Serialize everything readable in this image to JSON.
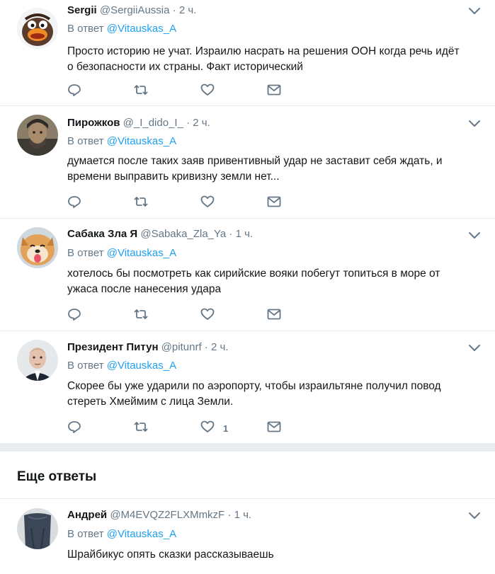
{
  "replies": [
    {
      "name": "Sergii",
      "handle": "@SergiiAussia",
      "dot": "·",
      "time": "2 ч.",
      "reply_prefix": "В ответ",
      "reply_to": "@Vitauskas_A",
      "text_lines": [
        "Просто историю не учат. Израилю насрать на решения ООН когда речь идёт",
        "о безопасности их страны. Факт исторический"
      ],
      "likes": ""
    },
    {
      "name": "Пирожков",
      "handle": "@_I_dido_I_",
      "dot": "·",
      "time": "2 ч.",
      "reply_prefix": "В ответ",
      "reply_to": "@Vitauskas_A",
      "text_lines": [
        "думается после таких заяв привентивный удар не заставит себя ждать, и",
        "времени выправить кривизну земли нет..."
      ],
      "likes": ""
    },
    {
      "name": "Сабака Зла Я",
      "handle": "@Sabaka_Zla_Ya",
      "dot": "·",
      "time": "1 ч.",
      "reply_prefix": "В ответ",
      "reply_to": "@Vitauskas_A",
      "text_lines": [
        "хотелось бы посмотреть как сирийские вояки побегут топиться в море от",
        "ужаса после нанесения удара"
      ],
      "likes": ""
    },
    {
      "name": "Президент Питун",
      "handle": "@pitunrf",
      "dot": "·",
      "time": "2 ч.",
      "reply_prefix": "В ответ",
      "reply_to": "@Vitauskas_A",
      "text_lines": [
        "Скорее бы уже ударили по аэропорту, чтобы израильтяне получил повод",
        "стереть Хмеймим с лица Земли."
      ],
      "likes": "1"
    }
  ],
  "more_replies_title": "Еще ответы",
  "more_replies": [
    {
      "name": "Андрей",
      "handle": "@M4EVQZ2FLXMmkzF",
      "dot": "·",
      "time": "1 ч.",
      "reply_prefix": "В ответ",
      "reply_to": "@Vitauskas_A",
      "text_lines": [
        "Шрайбикус опять сказки рассказываешь"
      ]
    }
  ],
  "icons": {
    "reply": "reply-icon",
    "retweet": "retweet-icon",
    "like": "heart-icon",
    "dm": "envelope-icon",
    "caret": "chevron-down-icon"
  },
  "colors": {
    "link": "#1da1f2",
    "muted": "#657786",
    "text": "#14171a",
    "divider": "#e6ecf0"
  }
}
